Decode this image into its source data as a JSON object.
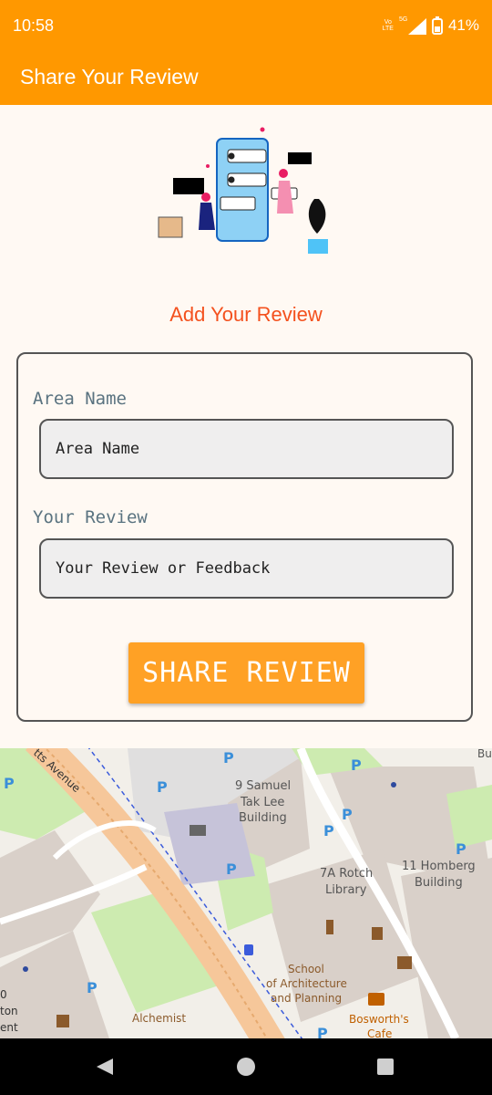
{
  "status_bar": {
    "time": "10:58",
    "battery": "41%",
    "network_top": "Vo",
    "network_bottom": "LTE",
    "signal_label": "5G"
  },
  "app_bar": {
    "title": "Share Your Review"
  },
  "form": {
    "heading": "Add Your Review",
    "area_label": "Area Name",
    "area_placeholder": "Area Name",
    "area_value": "",
    "review_label": "Your Review",
    "review_placeholder": "Your Review or Feedback",
    "review_value": "",
    "share_button": "SHARE REVIEW"
  },
  "map": {
    "labels": {
      "street": "tts Avenue",
      "samuel": "9 Samuel",
      "samuel2": "Tak Lee",
      "samuel3": "Building",
      "rotch": "7A Rotch",
      "rotch2": "Library",
      "homberg": "11 Homberg",
      "homberg2": "Building",
      "school": "School",
      "school2": "of Architecture",
      "school3": "and Planning",
      "alchemist": "Alchemist",
      "bosworth": "Bosworth's",
      "bosworth2": "Cafe",
      "edge1": "0",
      "edge2": "ton",
      "edge3": "ent",
      "bu": "Bu"
    }
  },
  "colors": {
    "primary": "#FF9800",
    "heading": "#F4511E",
    "button": "#FFA125",
    "label": "#5A7380"
  }
}
